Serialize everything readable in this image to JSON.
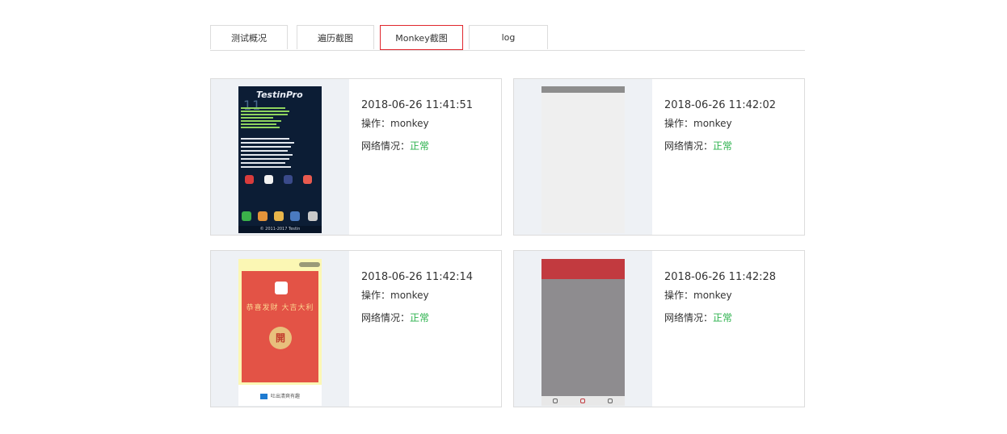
{
  "tabs": [
    {
      "label": "测试概况"
    },
    {
      "label": "遍历截图"
    },
    {
      "label": "Monkey截图"
    },
    {
      "label": "log"
    }
  ],
  "accent_color": "#e0262d",
  "status_ok_color": "#2bb24c",
  "cards": [
    {
      "time": "2018-06-26 11:41:51",
      "op_label": "操作：",
      "op_value": "monkey",
      "net_label": "网络情况：",
      "net_value": "正常",
      "thumb": {
        "brand": "TestinPro",
        "clock": "11",
        "footer": "© 2011-2017 Testin"
      }
    },
    {
      "time": "2018-06-26 11:42:02",
      "op_label": "操作：",
      "op_value": "monkey",
      "net_label": "网络情况：",
      "net_value": "正常"
    },
    {
      "time": "2018-06-26 11:42:14",
      "op_label": "操作：",
      "op_value": "monkey",
      "net_label": "网络情况：",
      "net_value": "正常",
      "thumb": {
        "slogan": "恭喜发财 大吉大利",
        "open": "開",
        "foot": "吐出清爽有趣"
      }
    },
    {
      "time": "2018-06-26 11:42:28",
      "op_label": "操作：",
      "op_value": "monkey",
      "net_label": "网络情况：",
      "net_value": "正常"
    }
  ]
}
